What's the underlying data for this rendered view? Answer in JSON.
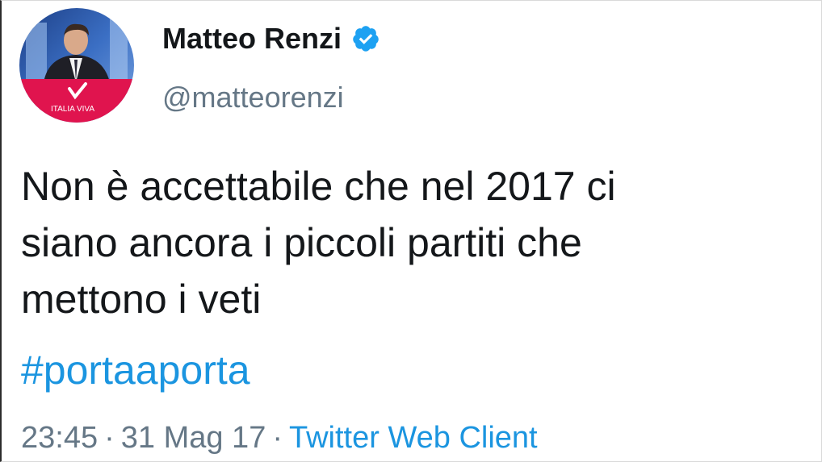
{
  "user": {
    "display_name": "Matteo Renzi",
    "handle": "@matteorenzi",
    "verified": true,
    "avatar_logo_text": "ITALIA VIVA"
  },
  "tweet": {
    "text": "Non è accettabile che nel 2017 ci\nsiano ancora i piccoli partiti che\nmettono i veti",
    "hashtag": "#portaaporta"
  },
  "meta": {
    "time": "23:45",
    "separator": "·",
    "date": "31 Mag 17",
    "source": "Twitter Web Client"
  },
  "colors": {
    "text": "#14171a",
    "secondary": "#657786",
    "link": "#1b95e0",
    "verified_badge": "#1da1f2",
    "avatar_studio_blue": "#2f5fb0",
    "avatar_brand_red": "#e0144e"
  },
  "icons": {
    "verified": "verified-badge-icon"
  }
}
